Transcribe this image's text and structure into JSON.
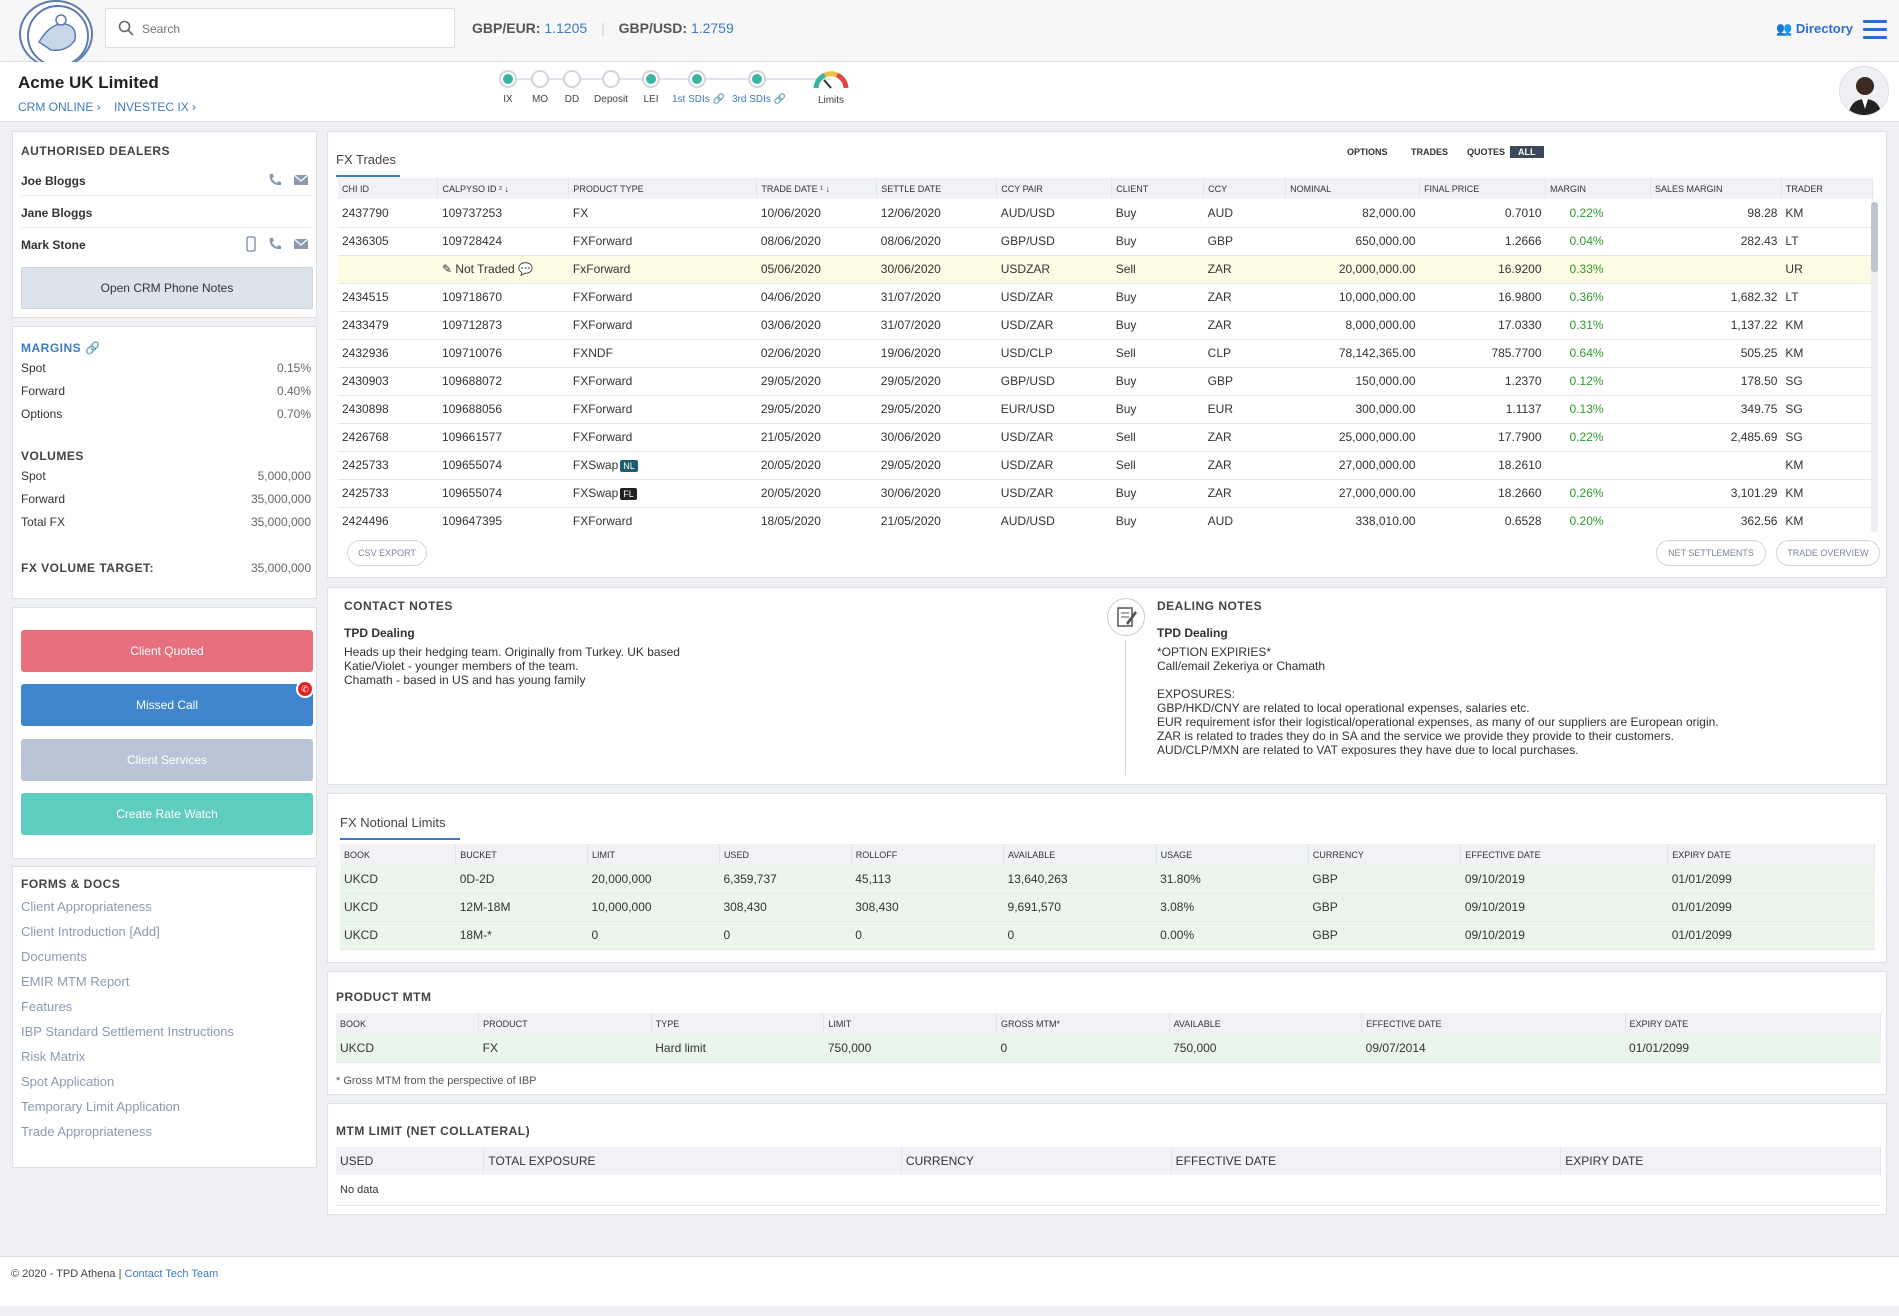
{
  "header": {
    "search_placeholder": "Search",
    "rates": [
      {
        "label": "GBP/EUR:",
        "value": "1.1205"
      },
      {
        "label": "GBP/USD:",
        "value": "1.2759"
      }
    ],
    "directory_label": "Directory"
  },
  "client": {
    "name": "Acme UK Limited",
    "links": [
      "CRM ONLINE ›",
      "INVESTEC IX ›"
    ]
  },
  "steps": [
    {
      "label": "IX",
      "state": "done",
      "link": false
    },
    {
      "label": "MO",
      "state": "todo",
      "link": false
    },
    {
      "label": "DD",
      "state": "todo",
      "link": false
    },
    {
      "label": "Deposit",
      "state": "todo",
      "link": false
    },
    {
      "label": "LEI",
      "state": "done",
      "link": false
    },
    {
      "label": "1st SDIs 🔗",
      "state": "done",
      "link": true
    },
    {
      "label": "3rd SDIs 🔗",
      "state": "done",
      "link": true
    },
    {
      "label": "Limits",
      "state": "gauge",
      "link": false
    }
  ],
  "dealers": {
    "title": "AUTHORISED DEALERS",
    "items": [
      {
        "name": "Joe Bloggs",
        "icons": [
          "phone-icon",
          "email-icon"
        ]
      },
      {
        "name": "Jane Bloggs",
        "icons": []
      },
      {
        "name": "Mark Stone",
        "icons": [
          "mobile-icon",
          "phone-icon",
          "email-icon"
        ]
      }
    ],
    "button": "Open CRM Phone Notes"
  },
  "margins": {
    "title": "MARGINS 🔗",
    "rows": [
      [
        "Spot",
        "0.15%"
      ],
      [
        "Forward",
        "0.40%"
      ],
      [
        "Options",
        "0.70%"
      ]
    ],
    "volumes_title": "VOLUMES",
    "volumes": [
      [
        "Spot",
        "5,000,000"
      ],
      [
        "Forward",
        "35,000,000"
      ],
      [
        "Total FX",
        "35,000,000"
      ]
    ],
    "target_label": "FX VOLUME TARGET:",
    "target_value": "35,000,000"
  },
  "actions": {
    "client_quoted": "Client Quoted",
    "missed_call": "Missed Call",
    "client_services": "Client Services",
    "rate_watch": "Create Rate Watch",
    "colors": {
      "quoted": "#e8707e",
      "missed": "#3f86cf",
      "services": "#b9c5d4",
      "watch": "#5ecdc0"
    }
  },
  "forms": {
    "title": "FORMS & DOCS",
    "items": [
      "Client Appropriateness",
      "Client Introduction [Add]",
      "Documents",
      "EMIR MTM Report",
      "Features",
      "IBP Standard Settlement Instructions",
      "Risk Matrix",
      "Spot Application",
      "Temporary Limit Application",
      "Trade Appropriateness"
    ]
  },
  "fx_trades": {
    "title": "FX Trades",
    "filters": [
      "OPTIONS",
      "TRADES",
      "QUOTES",
      "ALL"
    ],
    "columns": [
      "CHI ID",
      "CALPYSO ID ² ↓",
      "PRODUCT TYPE",
      "TRADE DATE ¹ ↓",
      "SETTLE DATE",
      "CCY PAIR",
      "CLIENT",
      "CCY",
      "NOMINAL",
      "FINAL PRICE",
      "MARGIN",
      "SALES MARGIN",
      "TRADER"
    ],
    "rows": [
      [
        "2437790",
        "109737253",
        "FX",
        "",
        "10/06/2020",
        "12/06/2020",
        "AUD/USD",
        "Buy",
        "AUD",
        "82,000.00",
        "0.7010",
        "0.22%",
        "98.28",
        "KM"
      ],
      [
        "2436305",
        "109728424",
        "FXForward",
        "",
        "08/06/2020",
        "08/06/2020",
        "GBP/USD",
        "Buy",
        "GBP",
        "650,000.00",
        "1.2666",
        "0.04%",
        "282.43",
        "LT"
      ],
      [
        "",
        "✎ Not Traded 💬",
        "FxForward",
        "",
        "05/06/2020",
        "30/06/2020",
        "USDZAR",
        "Sell",
        "ZAR",
        "20,000,000.00",
        "16.9200",
        "0.33%",
        "",
        "UR"
      ],
      [
        "2434515",
        "109718670",
        "FXForward",
        "",
        "04/06/2020",
        "31/07/2020",
        "USD/ZAR",
        "Buy",
        "ZAR",
        "10,000,000.00",
        "16.9800",
        "0.36%",
        "1,682.32",
        "LT"
      ],
      [
        "2433479",
        "109712873",
        "FXForward",
        "",
        "03/06/2020",
        "31/07/2020",
        "USD/ZAR",
        "Buy",
        "ZAR",
        "8,000,000.00",
        "17.0330",
        "0.31%",
        "1,137.22",
        "KM"
      ],
      [
        "2432936",
        "109710076",
        "FXNDF",
        "",
        "02/06/2020",
        "19/06/2020",
        "USD/CLP",
        "Sell",
        "CLP",
        "78,142,365.00",
        "785.7700",
        "0.64%",
        "505.25",
        "KM"
      ],
      [
        "2430903",
        "109688072",
        "FXForward",
        "",
        "29/05/2020",
        "29/05/2020",
        "GBP/USD",
        "Buy",
        "GBP",
        "150,000.00",
        "1.2370",
        "0.12%",
        "178.50",
        "SG"
      ],
      [
        "2430898",
        "109688056",
        "FXForward",
        "",
        "29/05/2020",
        "29/05/2020",
        "EUR/USD",
        "Buy",
        "EUR",
        "300,000.00",
        "1.1137",
        "0.13%",
        "349.75",
        "SG"
      ],
      [
        "2426768",
        "109661577",
        "FXForward",
        "",
        "21/05/2020",
        "30/06/2020",
        "USD/ZAR",
        "Sell",
        "ZAR",
        "25,000,000.00",
        "17.7900",
        "0.22%",
        "2,485.69",
        "SG"
      ],
      [
        "2425733",
        "109655074",
        "FXSwap",
        "NL",
        "20/05/2020",
        "29/05/2020",
        "USD/ZAR",
        "Sell",
        "ZAR",
        "27,000,000.00",
        "18.2610",
        "",
        "",
        "KM"
      ],
      [
        "2425733",
        "109655074",
        "FXSwap",
        "FL",
        "20/05/2020",
        "30/06/2020",
        "USD/ZAR",
        "Buy",
        "ZAR",
        "27,000,000.00",
        "18.2660",
        "0.26%",
        "3,101.29",
        "KM"
      ],
      [
        "2424496",
        "109647395",
        "FXForward",
        "",
        "18/05/2020",
        "21/05/2020",
        "AUD/USD",
        "Buy",
        "AUD",
        "338,010.00",
        "0.6528",
        "0.20%",
        "362.56",
        "KM"
      ]
    ],
    "csv": "CSV EXPORT",
    "net": "NET SETTLEMENTS",
    "overview": "TRADE OVERVIEW"
  },
  "contact_notes": {
    "title": "CONTACT NOTES",
    "sub": "TPD Dealing",
    "lines": [
      "Heads up their hedging team. Originally from Turkey. UK based",
      "Katie/Violet - younger members of the team.",
      "Chamath - based in US and has young family"
    ]
  },
  "dealing_notes": {
    "title": "DEALING NOTES",
    "sub": "TPD Dealing",
    "lines": [
      "*OPTION EXPIRIES*",
      "Call/email Zekeriya or Chamath",
      "",
      "EXPOSURES:",
      "GBP/HKD/CNY are related to local operational expenses, salaries etc.",
      "EUR requirement isfor their logistical/operational expenses, as many of our suppliers are European origin.",
      "ZAR is related to trades they do in SA and the service we provide they provide to their customers.",
      "AUD/CLP/MXN are related to VAT exposures they have due to local purchases."
    ]
  },
  "limits": {
    "title": "FX Notional Limits",
    "columns": [
      "BOOK",
      "BUCKET",
      "LIMIT",
      "USED",
      "ROLLOFF",
      "AVAILABLE",
      "USAGE",
      "CURRENCY",
      "EFFECTIVE DATE",
      "EXPIRY DATE"
    ],
    "rows": [
      [
        "UKCD",
        "0D-2D",
        "20,000,000",
        "6,359,737",
        "45,113",
        "13,640,263",
        "31.80%",
        "GBP",
        "09/10/2019",
        "01/01/2099"
      ],
      [
        "UKCD",
        "12M-18M",
        "10,000,000",
        "308,430",
        "308,430",
        "9,691,570",
        "3.08%",
        "GBP",
        "09/10/2019",
        "01/01/2099"
      ],
      [
        "UKCD",
        "18M-*",
        "0",
        "0",
        "0",
        "0",
        "0.00%",
        "GBP",
        "09/10/2019",
        "01/01/2099"
      ]
    ]
  },
  "product_mtm": {
    "title": "PRODUCT MTM",
    "columns": [
      "BOOK",
      "PRODUCT",
      "TYPE",
      "LIMIT",
      "GROSS MTM*",
      "AVAILABLE",
      "EFFECTIVE DATE",
      "EXPIRY DATE"
    ],
    "rows": [
      [
        "UKCD",
        "FX",
        "Hard limit",
        "750,000",
        "0",
        "750,000",
        "09/07/2014",
        "01/01/2099"
      ]
    ],
    "footnote": "* Gross MTM from the perspective of IBP"
  },
  "mtm_limit": {
    "title": "MTM LIMIT (NET COLLATERAL)",
    "columns": [
      "USED",
      "TOTAL EXPOSURE",
      "CURRENCY",
      "EFFECTIVE DATE",
      "EXPIRY DATE"
    ],
    "empty": "No data"
  },
  "footer": {
    "text": "© 2020 - TPD Athena |",
    "link": "Contact Tech Team"
  }
}
